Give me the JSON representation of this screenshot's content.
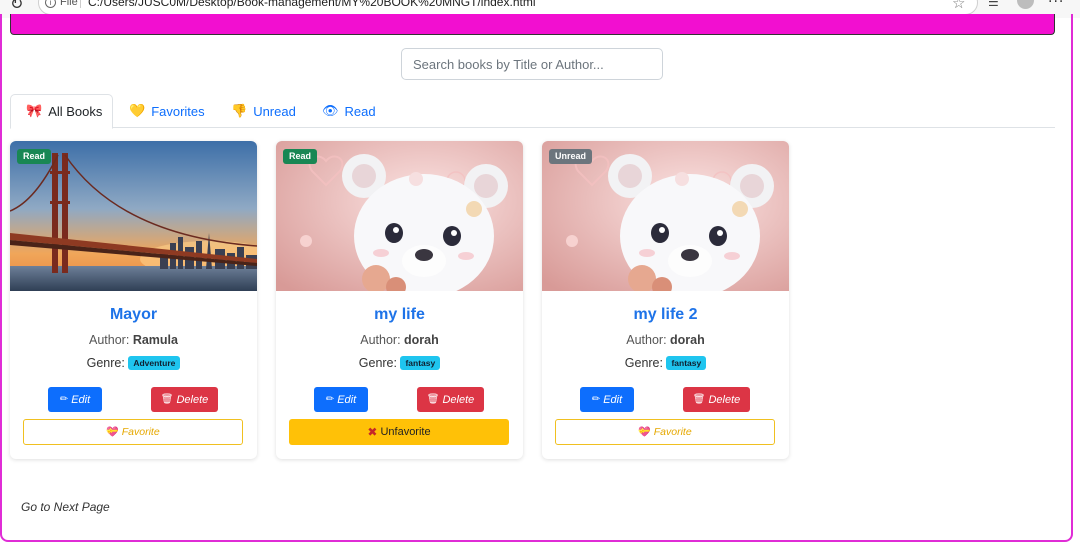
{
  "browser": {
    "file_label": "File",
    "url": "C:/Users/JUSC0M/Desktop/Book-management/MY%20BOOK%20MNGT/index.html"
  },
  "search": {
    "placeholder": "Search books by Title or Author..."
  },
  "tabs": [
    {
      "label": "All Books",
      "icon": "bow-icon",
      "glyph": "🎀"
    },
    {
      "label": "Favorites",
      "icon": "heart-icon",
      "glyph": "💛"
    },
    {
      "label": "Unread",
      "icon": "thumbs-down-icon",
      "glyph": "👎"
    },
    {
      "label": "Read",
      "icon": "eye-icon",
      "glyph": "👁"
    }
  ],
  "books": [
    {
      "status": "Read",
      "status_color": "#198754",
      "title": "Mayor",
      "author_label": "Author:",
      "author": "Ramula",
      "genre_label": "Genre:",
      "genre": "Adventure",
      "edit_label": "Edit",
      "delete_label": "Delete",
      "favorite_label": "Favorite",
      "is_favorite": false,
      "cover": "bridge-sunset"
    },
    {
      "status": "Read",
      "status_color": "#198754",
      "title": "my life",
      "author_label": "Author:",
      "author": "dorah",
      "genre_label": "Genre:",
      "genre": "fantasy",
      "edit_label": "Edit",
      "delete_label": "Delete",
      "favorite_label": "Unfavorite",
      "is_favorite": true,
      "cover": "teddy-bear"
    },
    {
      "status": "Unread",
      "status_color": "#6c757d",
      "title": "my life 2",
      "author_label": "Author:",
      "author": "dorah",
      "genre_label": "Genre:",
      "genre": "fantasy",
      "edit_label": "Edit",
      "delete_label": "Delete",
      "favorite_label": "Favorite",
      "is_favorite": false,
      "cover": "teddy-bear"
    }
  ],
  "pagination": {
    "next_label": "Go to Next Page"
  },
  "colors": {
    "accent": "#0d6efd",
    "danger": "#dc3545",
    "warning": "#ffc107",
    "frame": "#e02cd6"
  }
}
